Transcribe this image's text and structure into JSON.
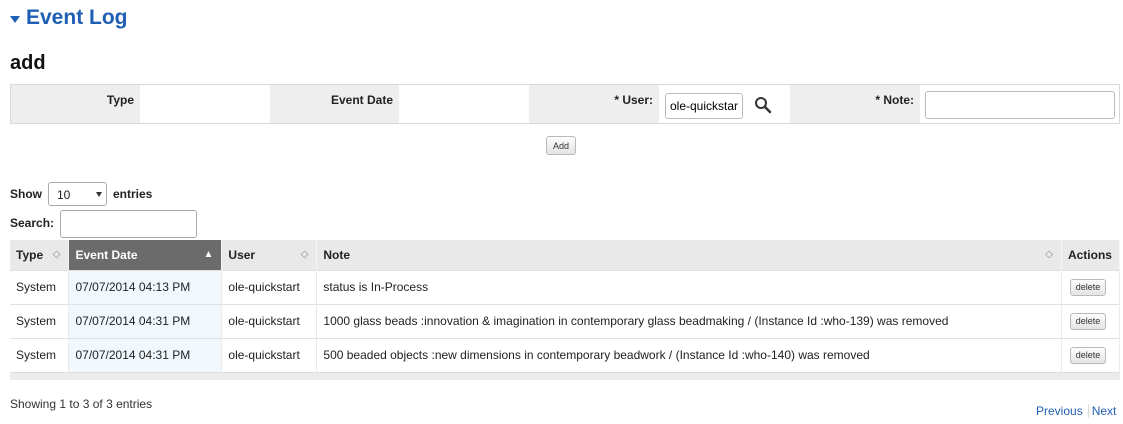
{
  "section": {
    "title": "Event Log"
  },
  "add_form": {
    "title": "add",
    "type_label": "Type",
    "event_date_label": "Event Date",
    "user_label": "* User:",
    "user_value": "ole-quickstart",
    "note_label": "* Note:",
    "note_value": "",
    "add_button": "Add"
  },
  "table_controls": {
    "show_label": "Show",
    "entries_value": "10",
    "entries_label": "entries",
    "search_label": "Search:",
    "search_value": ""
  },
  "table": {
    "headers": [
      "Type",
      "Event Date",
      "User",
      "Note",
      "Actions"
    ],
    "rows": [
      {
        "type": "System",
        "date": "07/07/2014 04:13 PM",
        "user": "ole-quickstart",
        "note": "status is In-Process",
        "action": "delete"
      },
      {
        "type": "System",
        "date": "07/07/2014 04:31 PM",
        "user": "ole-quickstart",
        "note": "1000 glass beads :innovation & imagination in contemporary glass beadmaking / (Instance Id :who-139) was removed",
        "action": "delete"
      },
      {
        "type": "System",
        "date": "07/07/2014 04:31 PM",
        "user": "ole-quickstart",
        "note": "500 beaded objects :new dimensions in contemporary beadwork / (Instance Id :who-140) was removed",
        "action": "delete"
      }
    ]
  },
  "footer": {
    "info": "Showing 1 to 3 of 3 entries",
    "previous": "Previous",
    "next": "Next"
  },
  "colors": {
    "accent": "#1f5fb3",
    "sorted_header": "#6b6b6b"
  }
}
